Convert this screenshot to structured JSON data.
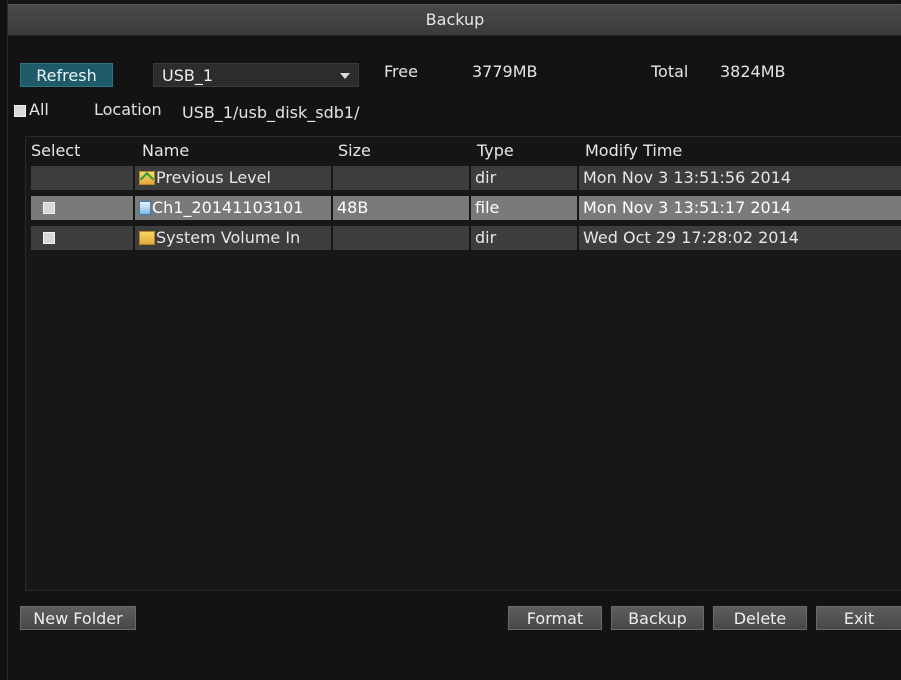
{
  "window": {
    "title": "Backup"
  },
  "toolbar": {
    "refresh_label": "Refresh",
    "device_selected": "USB_1",
    "free_label": "Free",
    "free_value": "3779MB",
    "total_label": "Total",
    "total_value": "3824MB",
    "all_label": "All",
    "location_label": "Location",
    "location_value": "USB_1/usb_disk_sdb1/"
  },
  "table": {
    "headers": {
      "select": "Select",
      "name": "Name",
      "size": "Size",
      "type": "Type",
      "modify": "Modify Time"
    },
    "rows": [
      {
        "name": "Previous Level",
        "size": "",
        "type": "dir",
        "modify": "Mon Nov  3 13:51:56 2014",
        "icon": "folder-up-icon",
        "has_checkbox": false,
        "selected": false
      },
      {
        "name": "Ch1_20141103101",
        "size": "48B",
        "type": "file",
        "modify": "Mon Nov  3 13:51:17 2014",
        "icon": "video-file-icon",
        "has_checkbox": true,
        "selected": true
      },
      {
        "name": "System Volume In",
        "size": "",
        "type": "dir",
        "modify": "Wed Oct 29 17:28:02 2014",
        "icon": "folder-icon",
        "has_checkbox": true,
        "selected": false
      }
    ]
  },
  "buttons": {
    "new_folder": "New Folder",
    "format": "Format",
    "backup": "Backup",
    "delete": "Delete",
    "exit": "Exit"
  },
  "colors": {
    "accent": "#1f5a68",
    "selected_row": "#7a7a7a",
    "row": "#3d3d3d"
  }
}
